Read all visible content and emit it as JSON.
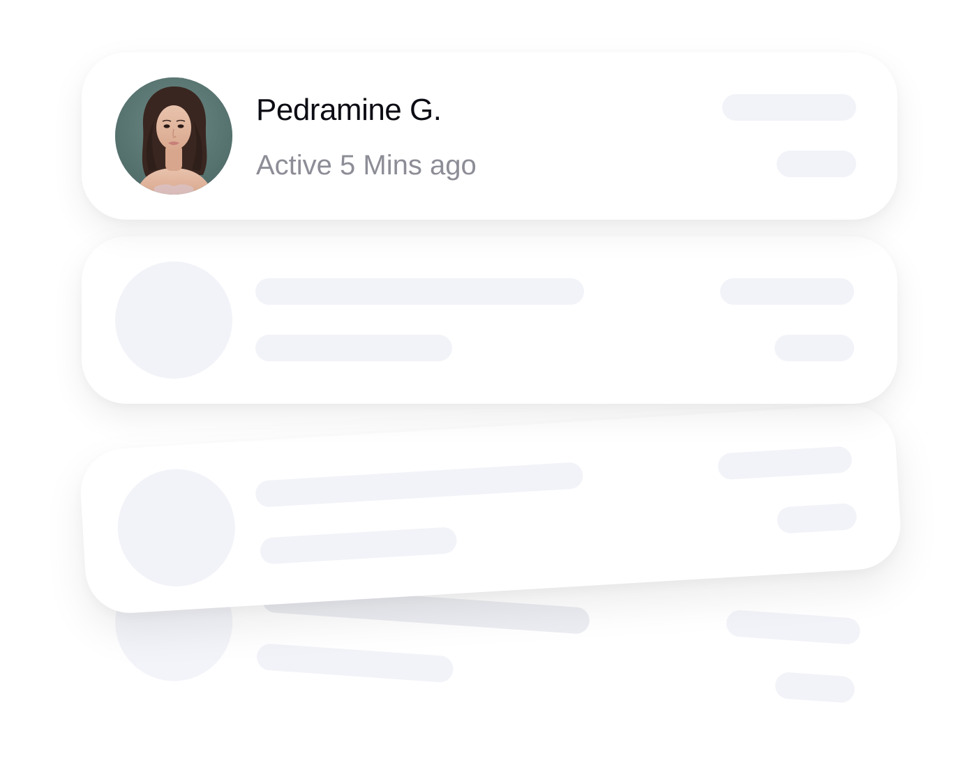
{
  "user_card": {
    "name": "Pedramine G.",
    "status": "Active 5 Mins ago",
    "avatar": "portrait-photo"
  },
  "placeholder_cards": 3
}
